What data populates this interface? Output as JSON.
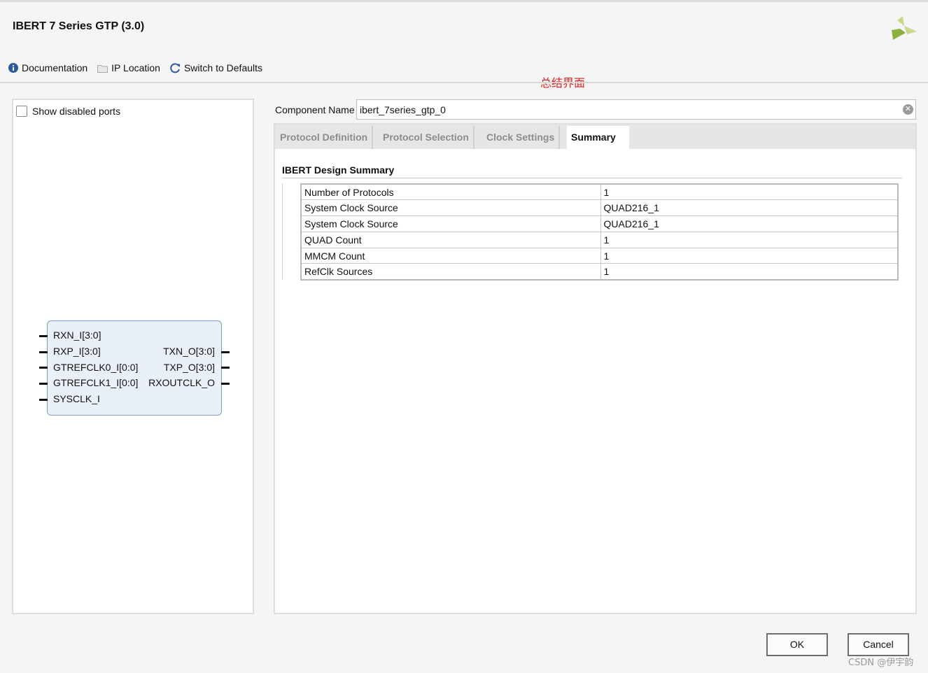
{
  "dialog": {
    "title": "IBERT 7 Series GTP (3.0)"
  },
  "toolbar": {
    "documentation": "Documentation",
    "ip_location": "IP Location",
    "switch_defaults": "Switch to Defaults"
  },
  "annotation": "总结界面",
  "left_panel": {
    "show_disabled_ports": "Show disabled ports",
    "show_disabled_ports_checked": false,
    "block": {
      "inputs": [
        "RXN_I[3:0]",
        "RXP_I[3:0]",
        "GTREFCLK0_I[0:0]",
        "GTREFCLK1_I[0:0]",
        "SYSCLK_I"
      ],
      "outputs": [
        "TXN_O[3:0]",
        "TXP_O[3:0]",
        "RXOUTCLK_O"
      ]
    }
  },
  "component": {
    "label": "Component Name",
    "value": "ibert_7series_gtp_0"
  },
  "tabs": [
    {
      "label": "Protocol Definition",
      "active": false
    },
    {
      "label": "Protocol Selection",
      "active": false
    },
    {
      "label": "Clock Settings",
      "active": false
    },
    {
      "label": "Summary",
      "active": true
    }
  ],
  "summary": {
    "title": "IBERT Design Summary",
    "rows": [
      {
        "name": "Number of Protocols",
        "value": "1"
      },
      {
        "name": "System Clock Source",
        "value": "QUAD216_1"
      },
      {
        "name": "System Clock Source",
        "value": "QUAD216_1"
      },
      {
        "name": "QUAD Count",
        "value": "1"
      },
      {
        "name": "MMCM Count",
        "value": "1"
      },
      {
        "name": "RefClk Sources",
        "value": "1"
      }
    ]
  },
  "buttons": {
    "ok": "OK",
    "cancel": "Cancel"
  },
  "watermark": "CSDN @伊宇韵",
  "colors": {
    "annotation": "#e0201e",
    "logo": "#8cb040",
    "block_fill": "#eaf0f8",
    "block_border": "#7f9bcb",
    "info_icon": "#2c5aa0"
  }
}
